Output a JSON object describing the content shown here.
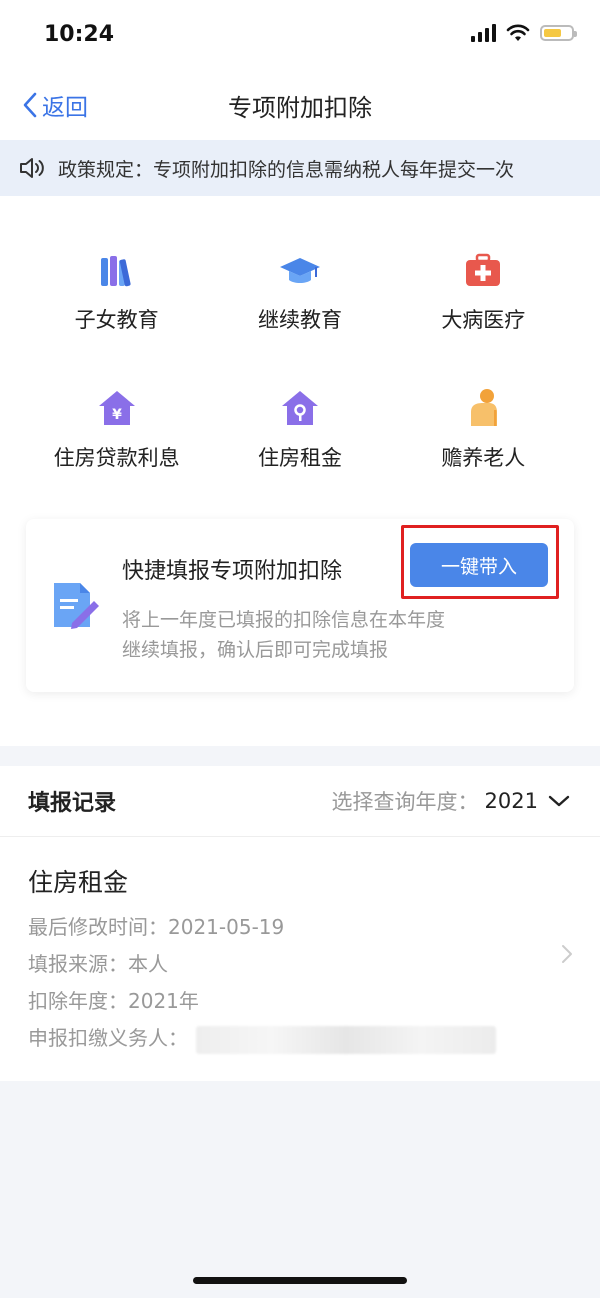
{
  "status": {
    "time": "10:24"
  },
  "nav": {
    "back_label": "返回",
    "title": "专项附加扣除"
  },
  "notice": {
    "text": "政策规定：专项附加扣除的信息需纳税人每年提交一次"
  },
  "categories": [
    {
      "label": "子女教育",
      "icon": "books-icon"
    },
    {
      "label": "继续教育",
      "icon": "graduation-cap-icon"
    },
    {
      "label": "大病医疗",
      "icon": "medical-kit-icon"
    },
    {
      "label": "住房贷款利息",
      "icon": "house-yuan-icon"
    },
    {
      "label": "住房租金",
      "icon": "house-key-icon"
    },
    {
      "label": "赡养老人",
      "icon": "elderly-icon"
    }
  ],
  "quick": {
    "title": "快捷填报专项附加扣除",
    "button": "一键带入",
    "description": "将上一年度已填报的扣除信息在本年度继续填报，确认后即可完成填报"
  },
  "records": {
    "title": "填报记录",
    "year_label": "选择查询年度：",
    "year": "2021",
    "item": {
      "name": "住房租金",
      "modified_label": "最后修改时间：",
      "modified_value": "2021-05-19",
      "source_label": "填报来源：",
      "source_value": "本人",
      "year_label": "扣除年度：",
      "year_value": "2021年",
      "agent_label": "申报扣缴义务人："
    }
  },
  "colors": {
    "accent": "#4a86e8",
    "highlight": "#e02020",
    "icon_purple": "#8a6fe8",
    "icon_red": "#e8584d",
    "icon_orange": "#f2a23a"
  }
}
